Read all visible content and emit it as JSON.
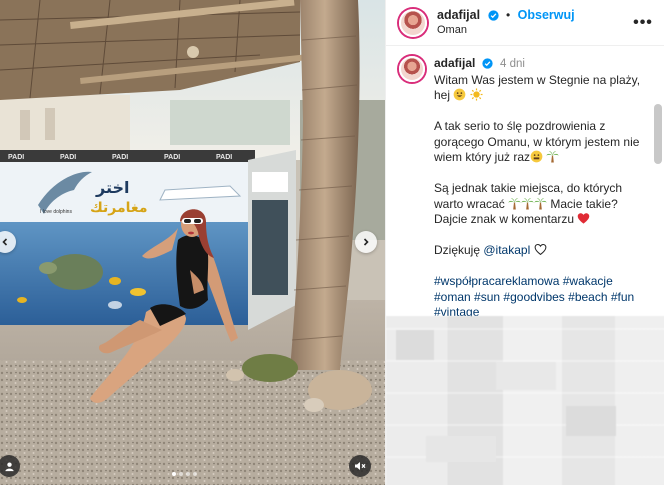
{
  "header": {
    "username": "adafijal",
    "separator": "•",
    "follow_label": "Obserwuj",
    "location": "Oman",
    "more_label": "•••"
  },
  "caption": {
    "username": "adafijal",
    "time": "4 dni",
    "line1": "Witam Was jestem w Stegnie na plaży,",
    "line2": "hej",
    "line3": "A tak serio to ślę pozdrowienia z",
    "line4": "gorącego Omanu, w którym jestem nie",
    "line5": "wiem który już raz",
    "line6": "Są jednak takie miejsca, do których",
    "line7": "warto wracać",
    "line7b": "Macie takie?",
    "line8": "Dajcie znak w komentarzu",
    "thanks": "Dziękuję",
    "mention": "@itakapl",
    "hashtags": [
      "#współpracareklamowa",
      "#wakacje",
      "#oman",
      "#sun",
      "#goodvibes",
      "#beach",
      "#fun",
      "#vintage"
    ]
  },
  "media": {
    "mural_text_1": "اختر",
    "mural_text_2": "مغامرتك",
    "mural_small": "I love dolphins",
    "banner_text": "PADI",
    "dots": 4,
    "active_dot": 0
  },
  "colors": {
    "accent_link": "#0095f6",
    "hashtag": "#00376b",
    "verified_badge": "#0095f6",
    "heart": "#ed4956"
  },
  "icons": {
    "verified": "verified-badge-icon",
    "more": "more-options-icon",
    "prev": "chevron-left-icon",
    "next": "chevron-right-icon",
    "tags": "user-tag-icon",
    "mute": "muted-speaker-icon",
    "heart": "heart-outline-icon"
  }
}
